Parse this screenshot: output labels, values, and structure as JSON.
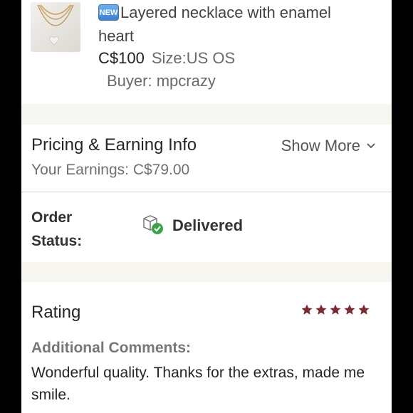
{
  "product": {
    "badge": "NEW",
    "title_line1": "Layered necklace with enamel",
    "title_line2": "heart",
    "price": "C$100",
    "size": "Size:US OS",
    "buyer": "Buyer: mpcrazy"
  },
  "pricing": {
    "title": "Pricing & Earning Info",
    "show_more": "Show More",
    "earnings": "Your Earnings: C$79.00"
  },
  "order_status": {
    "label_line1": "Order",
    "label_line2": "Status:",
    "value": "Delivered",
    "icon": "package-delivered-icon"
  },
  "rating": {
    "title": "Rating",
    "stars": 5,
    "max_stars": 5,
    "star_color": "#7b2a33",
    "comments_label": "Additional Comments:",
    "comments": "Wonderful quality. Thanks for the extras, made me smile."
  },
  "colors": {
    "background": "#f8f6f1",
    "card": "#ffffff",
    "delivered_check": "#3aa34a",
    "new_badge": "#4a8bd8"
  }
}
